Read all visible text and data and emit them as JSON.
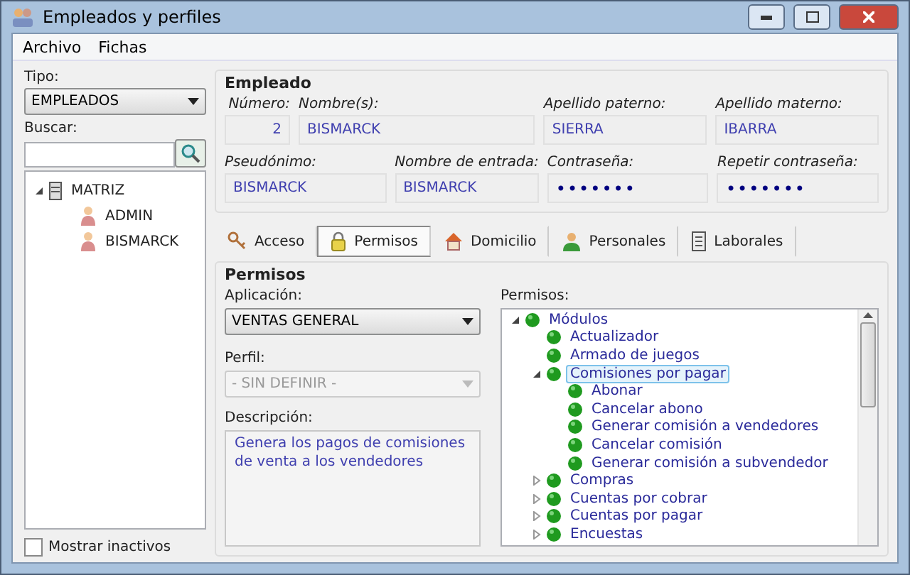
{
  "window": {
    "title": "Empleados y perfiles"
  },
  "menu": [
    {
      "label": "Archivo"
    },
    {
      "label": "Fichas"
    }
  ],
  "sidebar": {
    "type_label": "Tipo:",
    "type_value": "EMPLEADOS",
    "search_label": "Buscar:",
    "tree": [
      {
        "label": "MATRIZ",
        "kind": "server",
        "expanded": true,
        "children": [
          {
            "label": "ADMIN",
            "kind": "user"
          },
          {
            "label": "BISMARCK",
            "kind": "user"
          }
        ]
      }
    ],
    "show_inactive": {
      "label": "Mostrar inactivos",
      "checked": false
    }
  },
  "employee": {
    "title": "Empleado",
    "rows": [
      [
        {
          "label": "Número:",
          "value": "2",
          "kind": "number"
        },
        {
          "label": "Nombre(s):",
          "value": "BISMARCK",
          "kind": "text"
        },
        {
          "label": "Apellido paterno:",
          "value": "SIERRA",
          "kind": "text"
        },
        {
          "label": "Apellido materno:",
          "value": "IBARRA",
          "kind": "text"
        }
      ],
      [
        {
          "label": "Pseudónimo:",
          "value": "BISMARCK",
          "kind": "text"
        },
        {
          "label": "Nombre de entrada:",
          "value": "BISMARCK",
          "kind": "text"
        },
        {
          "label": "Contraseña:",
          "value": "•••••••",
          "kind": "password"
        },
        {
          "label": "Repetir contraseña:",
          "value": "•••••••",
          "kind": "password"
        }
      ]
    ]
  },
  "tabs": [
    {
      "label": "Acceso",
      "kind": "key",
      "selected": false
    },
    {
      "label": "Permisos",
      "kind": "lock",
      "selected": true
    },
    {
      "label": "Domicilio",
      "kind": "house",
      "selected": false
    },
    {
      "label": "Personales",
      "kind": "person",
      "selected": false
    },
    {
      "label": "Laborales",
      "kind": "file",
      "selected": false
    }
  ],
  "permissions": {
    "title": "Permisos",
    "application": {
      "label": "Aplicación:",
      "value": "VENTAS GENERAL"
    },
    "profile": {
      "label": "Perfil:",
      "value": "- SIN DEFINIR -",
      "disabled": true
    },
    "description": {
      "label": "Descripción:",
      "value": "Genera los pagos de comisiones de venta a los vendedores"
    },
    "tree_label": "Permisos:",
    "tree": [
      {
        "label": "Módulos",
        "expanded": true,
        "selected": false,
        "children": [
          {
            "label": "Actualizador",
            "selected": false
          },
          {
            "label": "Armado de juegos",
            "selected": false
          },
          {
            "label": "Comisiones por pagar",
            "expanded": true,
            "selected": true,
            "children": [
              {
                "label": "Abonar",
                "selected": false
              },
              {
                "label": "Cancelar abono",
                "selected": false
              },
              {
                "label": "Generar comisión a vendedores",
                "selected": false
              },
              {
                "label": "Cancelar comisión",
                "selected": false
              },
              {
                "label": "Generar comisión a subvendedor",
                "selected": false
              }
            ]
          },
          {
            "label": "Compras",
            "expanded": false,
            "selected": false
          },
          {
            "label": "Cuentas por cobrar",
            "expanded": false,
            "selected": false
          },
          {
            "label": "Cuentas por pagar",
            "expanded": false,
            "selected": false
          },
          {
            "label": "Encuestas",
            "expanded": false,
            "selected": false
          }
        ]
      }
    ]
  }
}
